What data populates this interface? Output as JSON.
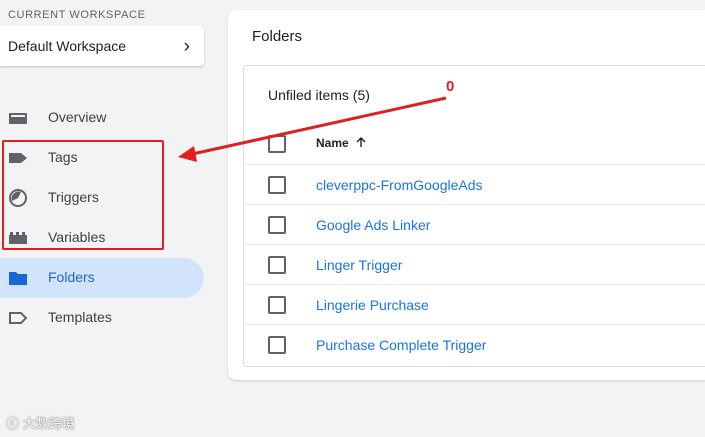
{
  "workspace": {
    "section_label": "CURRENT WORKSPACE",
    "name": "Default Workspace"
  },
  "nav": [
    {
      "label": "Overview",
      "icon": "overview-icon",
      "active": false
    },
    {
      "label": "Tags",
      "icon": "tag-icon",
      "active": false
    },
    {
      "label": "Triggers",
      "icon": "trigger-icon",
      "active": false
    },
    {
      "label": "Variables",
      "icon": "variables-icon",
      "active": false
    },
    {
      "label": "Folders",
      "icon": "folder-icon",
      "active": true
    },
    {
      "label": "Templates",
      "icon": "template-icon",
      "active": false
    }
  ],
  "main": {
    "title": "Folders",
    "folder": {
      "title": "Unfiled items (5)",
      "column_name": "Name",
      "sort_icon": "arrow-up-icon",
      "items": [
        "cleverppc-FromGoogleAds",
        "Google Ads Linker",
        "Linger Trigger",
        "Lingerie Purchase",
        "Purchase Complete Trigger"
      ]
    }
  },
  "annotation": {
    "number": "0",
    "color": "#e02020"
  },
  "watermark": "大数跨境",
  "colors": {
    "link": "#1a73e8",
    "active_bg": "#d2e3fc",
    "active_text": "#1967d2",
    "background": "#f1f3f4"
  }
}
